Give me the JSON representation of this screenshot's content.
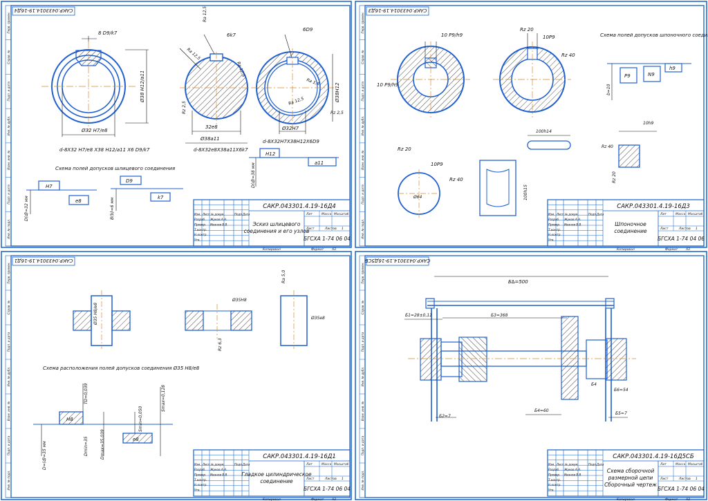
{
  "colors": {
    "frame": "#1560c8",
    "line": "#1f5fd0",
    "ink": "#111111",
    "center": "#d9882a",
    "hatch": "#333333"
  },
  "sheets": [
    {
      "id": "s1",
      "stamp_top": "САКР.0433014.19-16Д4",
      "doc_code": "САКР.043301.4.19-16Д4",
      "title_lines": [
        "Эскиз шлицевого",
        "соединения и его узлов"
      ],
      "org": "БГСХА 1-74 06 04",
      "scheme_caption": "Схема полей допусков шлицевого соединения",
      "dims": {
        "d9k7": "8 D9/k7",
        "phi32h7": "Ø32 H7/e8",
        "phi38h12": "Ø38 H12/a11",
        "fit_main": "d-8X32 H7/e8 X38 H12/a11 X6 D9/k7",
        "sixk7": "6k7",
        "ra125": "Ra 12,5",
        "rz25": "Rz 2,5",
        "phi32e8": "32e8",
        "phi38a11": "Ø38a11",
        "fit_shaft": "d-8X32e8X38a11X6k7",
        "sixd9": "6D9",
        "ra16": "Ra 1,6",
        "phi38h12b": "Ø38H12",
        "phi32h7b": "Ø32H7",
        "fit_hole": "d-8X32H7X38H12X6D9",
        "h7": "H7",
        "e8": "e8",
        "d9": "D9",
        "k7": "k7",
        "h12": "H12",
        "a11": "a11",
        "dnom32": "D(d)=32 мм",
        "bnom6": "B(b)=6 мм",
        "dnom38": "D(d)=38 мм"
      }
    },
    {
      "id": "s2",
      "stamp_top": "САКР.0433014.19-16Д3",
      "doc_code": "САКР.043301.4.19-16Д3",
      "title_lines": [
        "Шпоночное",
        "соединение"
      ],
      "org": "БГСХА 1-74 04 06",
      "scheme_caption": "Схема полей допусков шпоночного соединения",
      "dims": {
        "p9h9": "10 P9/h9",
        "rz20": "Rz 20",
        "rz40": "Rz 40",
        "tenp9": "10P9",
        "phi64": "Ø64",
        "len100": "100h14",
        "len100b": "100h15",
        "tenh9": "10h9",
        "p9": "P9",
        "n9": "N9",
        "h9": "h9",
        "b10": "b=10"
      }
    },
    {
      "id": "s3",
      "stamp_top": "САКР.0433014.19-16Д1",
      "doc_code": "САКР.043301.4.19-16Д1",
      "title_lines": [
        "Гладкое цилиндрическое",
        "соединение"
      ],
      "org": "БГСХА 1-74 06 04",
      "scheme_caption": "Схема расположения полей допусков соединения Ø35 H8/e8",
      "dims": {
        "fit35": "Ø35 H8/e8",
        "hole35": "Ø35H8",
        "shaft35": "Ø35e8",
        "ra5": "Ra 5,0",
        "rz63": "Rz 6,3",
        "h8": "H8",
        "e8": "e8",
        "dmax": "Dmax=35,039",
        "dmin": "Dmin=35",
        "smax": "Smax=0,128",
        "smin": "Smin=0,050",
        "td": "TD=0,039",
        "dnom": "D=(d)=35 мм"
      }
    },
    {
      "id": "s4",
      "stamp_top": "САКР.0433014.19-16Д5СБ",
      "doc_code": "САКР.043301.4.19-16Д5СБ",
      "title_lines": [
        "Схема сборочной",
        "размерной цепи",
        "Сборочный чертеж"
      ],
      "org": "БГСХА 1-74 06 04",
      "dims": {
        "b500": "Б∆=500",
        "b28": "Б1=28±0,11",
        "b368": "Б3=368",
        "b7a": "Б2=7",
        "b60": "Б4=60",
        "b7b": "Б5=7",
        "b54": "Б6=54",
        "b4": "Б4"
      }
    }
  ],
  "stamp_labels": {
    "izm": "Изм.",
    "list": "Лист",
    "ndok": "№ докум.",
    "podp": "Подп.",
    "data": "Дата",
    "razrab": "Разраб.",
    "prov": "Провер.",
    "tkontr": "Т.контр.",
    "nkontr": "Н.контр.",
    "utv": "Утв.",
    "lit": "Лит",
    "massa": "Масса",
    "masshtab": "Масштаб",
    "listov": "Листов",
    "sheet_n": "1",
    "author": "Жуков А.А.",
    "checker": "Иванов В.В.",
    "kopiroval": "Копировал",
    "format": "Формат",
    "a3": "А3"
  },
  "side_labels": [
    "Перв. примен.",
    "Справ. №",
    "Подп. и дата",
    "Инв. № дубл.",
    "Взам. инв. №",
    "Подп. и дата",
    "Инв. № подл."
  ]
}
